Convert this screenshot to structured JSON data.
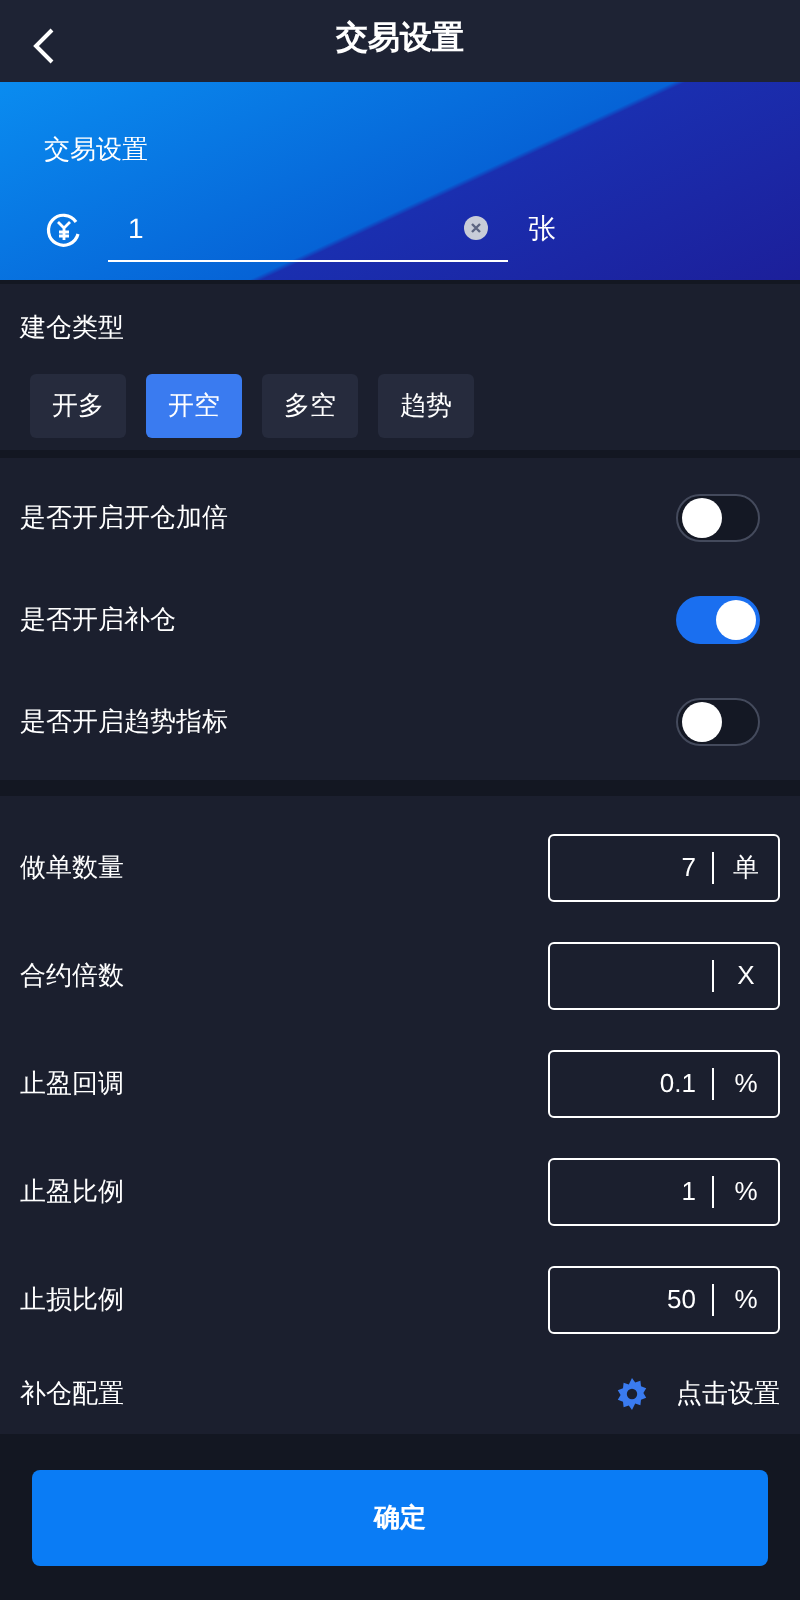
{
  "header": {
    "title": "交易设置"
  },
  "banner": {
    "title": "交易设置",
    "amount": {
      "value": "1",
      "unit": "张"
    }
  },
  "position_type": {
    "label": "建仓类型",
    "options": [
      {
        "label": "开多",
        "selected": false
      },
      {
        "label": "开空",
        "selected": true
      },
      {
        "label": "多空",
        "selected": false
      },
      {
        "label": "趋势",
        "selected": false
      }
    ]
  },
  "switches": [
    {
      "label": "是否开启开仓加倍",
      "on": false
    },
    {
      "label": "是否开启补仓",
      "on": true
    },
    {
      "label": "是否开启趋势指标",
      "on": false
    }
  ],
  "fields": [
    {
      "label": "做单数量",
      "value": "7",
      "unit": "单"
    },
    {
      "label": "合约倍数",
      "unit": "X"
    },
    {
      "label": "止盈回调",
      "value": "0.1",
      "unit": "%"
    },
    {
      "label": "止盈比例",
      "value": "1",
      "unit": "%"
    },
    {
      "label": "止损比例",
      "value": "50",
      "unit": "%"
    }
  ],
  "refill": {
    "label": "补仓配置",
    "action": "点击设置"
  },
  "confirm_button": "确定"
}
